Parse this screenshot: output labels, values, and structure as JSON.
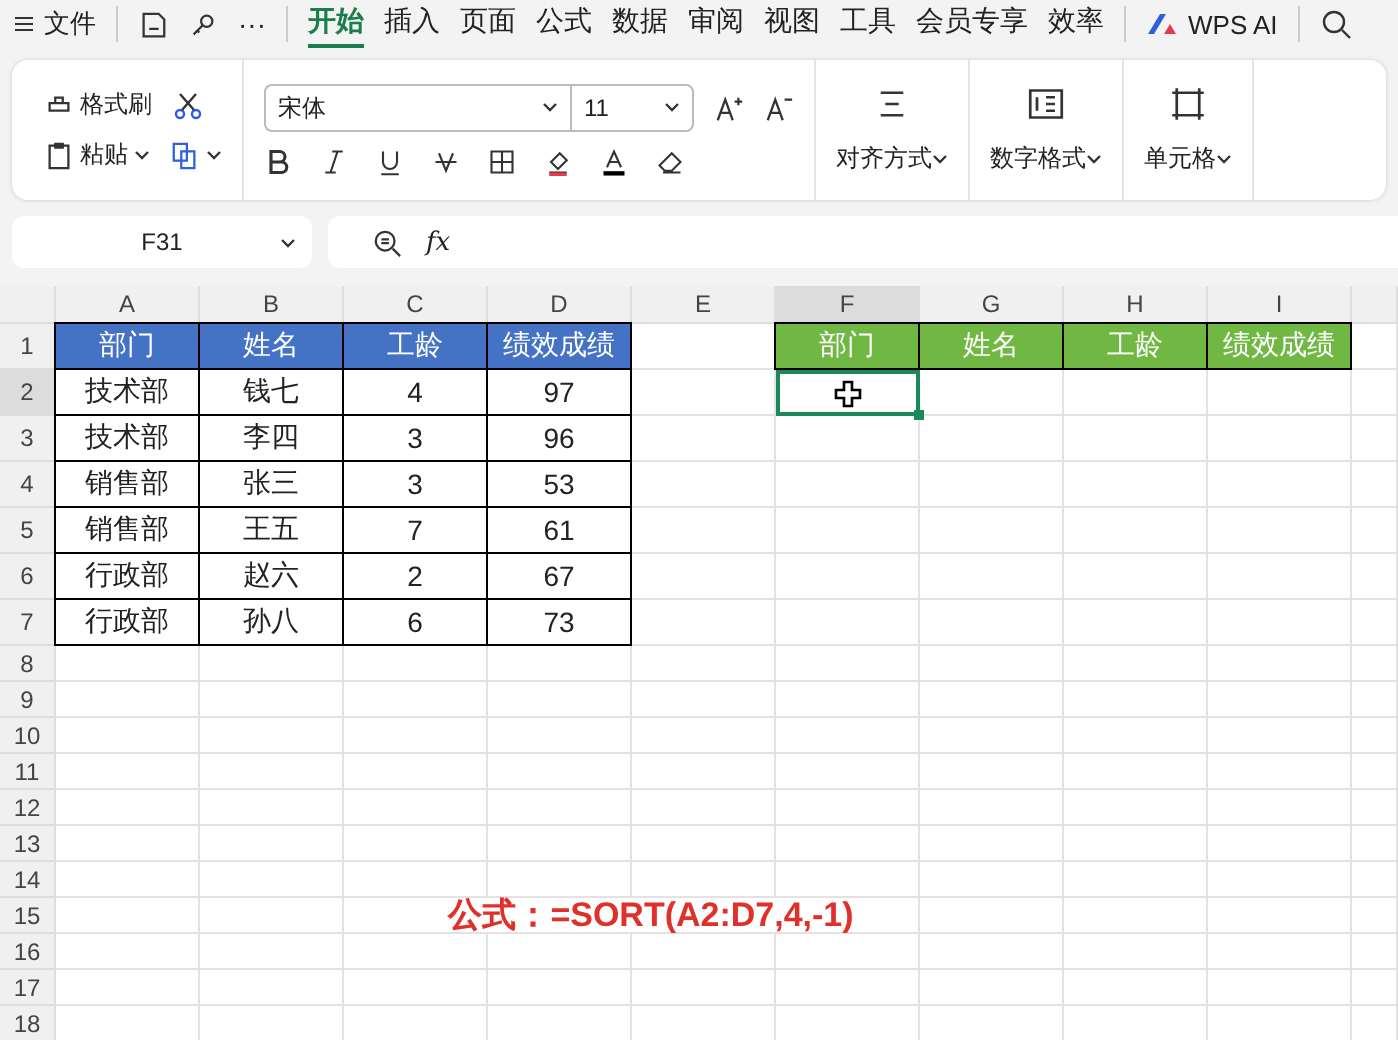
{
  "menu": {
    "file": "文件",
    "more": "···",
    "tabs": [
      {
        "label": "开始",
        "selected": true
      },
      {
        "label": "插入",
        "selected": false
      },
      {
        "label": "页面",
        "selected": false
      },
      {
        "label": "公式",
        "selected": false
      },
      {
        "label": "数据",
        "selected": false
      },
      {
        "label": "审阅",
        "selected": false
      },
      {
        "label": "视图",
        "selected": false
      },
      {
        "label": "工具",
        "selected": false
      },
      {
        "label": "会员专享",
        "selected": false
      },
      {
        "label": "效率",
        "selected": false
      }
    ],
    "ai": "WPS AI"
  },
  "ribbon": {
    "format_painter": "格式刷",
    "paste": "粘贴",
    "font": "宋体",
    "font_size": "11",
    "align": "对齐方式",
    "number_format": "数字格式",
    "cells": "单元格"
  },
  "formula_bar": {
    "name_box": "F31",
    "fx": "fx"
  },
  "sheet": {
    "columns": [
      {
        "label": "A",
        "selected": false
      },
      {
        "label": "B",
        "selected": false
      },
      {
        "label": "C",
        "selected": false
      },
      {
        "label": "D",
        "selected": false
      },
      {
        "label": "E",
        "selected": false
      },
      {
        "label": "F",
        "selected": true
      },
      {
        "label": "G",
        "selected": false
      },
      {
        "label": "H",
        "selected": false
      },
      {
        "label": "I",
        "selected": false
      }
    ],
    "rows": [
      {
        "label": "1",
        "selected": false
      },
      {
        "label": "2",
        "selected": true
      },
      {
        "label": "3",
        "selected": false
      },
      {
        "label": "4",
        "selected": false
      },
      {
        "label": "5",
        "selected": false
      },
      {
        "label": "6",
        "selected": false
      },
      {
        "label": "7",
        "selected": false
      },
      {
        "label": "8",
        "selected": false
      },
      {
        "label": "9",
        "selected": false
      },
      {
        "label": "10",
        "selected": false
      },
      {
        "label": "11",
        "selected": false
      },
      {
        "label": "12",
        "selected": false
      },
      {
        "label": "13",
        "selected": false
      },
      {
        "label": "14",
        "selected": false
      },
      {
        "label": "15",
        "selected": false
      },
      {
        "label": "16",
        "selected": false
      },
      {
        "label": "17",
        "selected": false
      },
      {
        "label": "18",
        "selected": false
      }
    ],
    "source_table": {
      "color": "#4472c4",
      "header": [
        "部门",
        "姓名",
        "工龄",
        "绩效成绩"
      ],
      "rows": [
        [
          "技术部",
          "钱七",
          "4",
          "97"
        ],
        [
          "技术部",
          "李四",
          "3",
          "96"
        ],
        [
          "销售部",
          "张三",
          "3",
          "53"
        ],
        [
          "销售部",
          "王五",
          "7",
          "61"
        ],
        [
          "行政部",
          "赵六",
          "2",
          "67"
        ],
        [
          "行政部",
          "孙八",
          "6",
          "73"
        ]
      ]
    },
    "result_table": {
      "color": "#70b843",
      "header": [
        "部门",
        "姓名",
        "工龄",
        "绩效成绩"
      ]
    },
    "formula_note": "公式：=SORT(A2:D7,4,-1)"
  }
}
